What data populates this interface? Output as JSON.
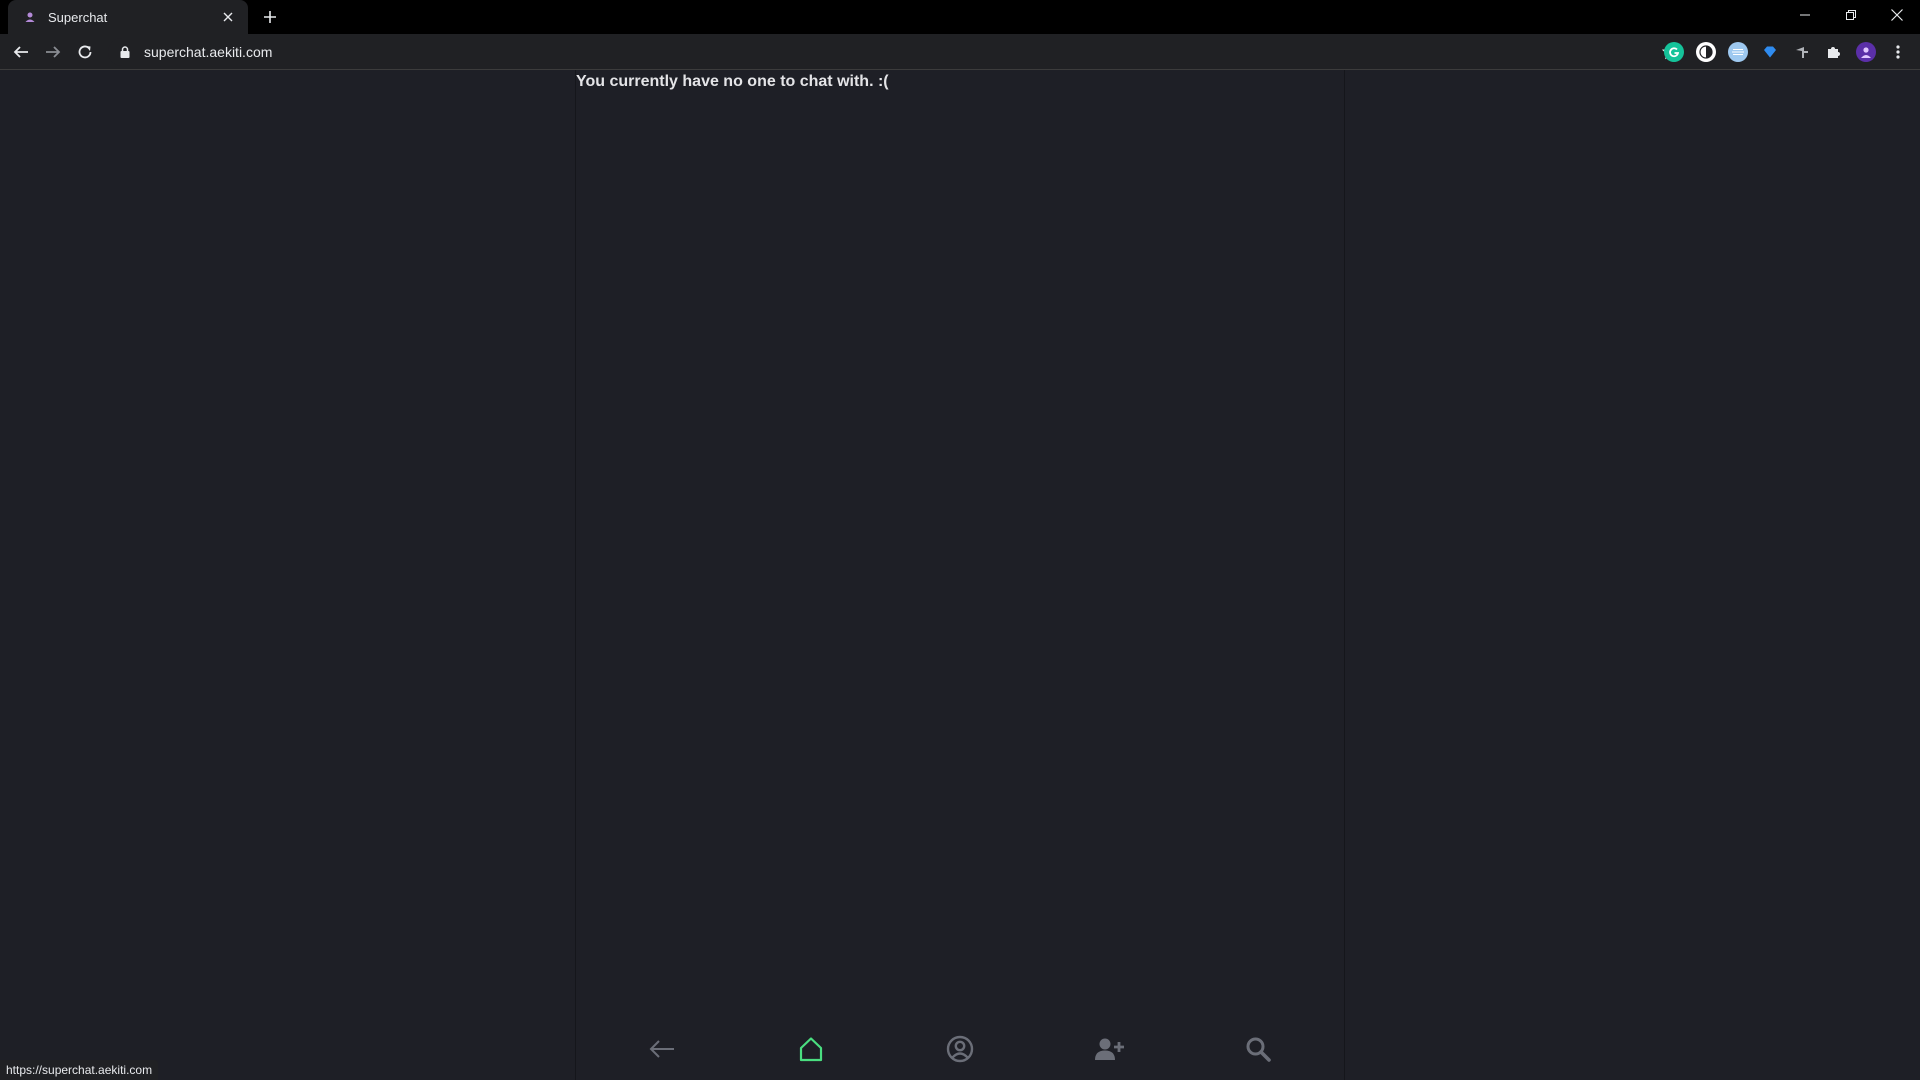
{
  "browser": {
    "tab_title": "Superchat",
    "url": "superchat.aekiti.com",
    "status_url": "https://superchat.aekiti.com"
  },
  "main": {
    "empty_message": "You currently have no one to chat with. :("
  },
  "colors": {
    "accent": "#4ade80",
    "page_bg": "#1e1f26",
    "nav_icon": "#6b6e78"
  },
  "bottom_nav": [
    {
      "icon": "arrow-left-icon"
    },
    {
      "icon": "home-icon",
      "active": true
    },
    {
      "icon": "profile-icon"
    },
    {
      "icon": "add-user-icon"
    },
    {
      "icon": "search-icon"
    }
  ]
}
